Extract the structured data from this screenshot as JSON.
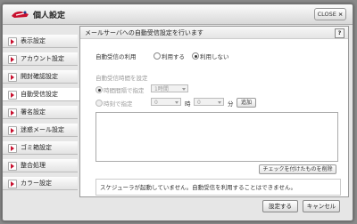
{
  "window": {
    "title": "個人設定",
    "close_label": "CLOSE",
    "close_x": "×"
  },
  "sidebar": {
    "items": [
      {
        "label": "表示設定"
      },
      {
        "label": "アカウント設定"
      },
      {
        "label": "開封確認設定"
      },
      {
        "label": "自動受信設定"
      },
      {
        "label": "署名設定"
      },
      {
        "label": "迷惑メール設定"
      },
      {
        "label": "ゴミ箱設定"
      },
      {
        "label": "整合処理"
      },
      {
        "label": "カラー設定"
      }
    ],
    "active_index": 3
  },
  "panel": {
    "title": "メールサーバへの自動受信設定を行います",
    "help_label": "?",
    "use_label": "自動受信の利用",
    "use_on_label": "利用する",
    "use_off_label": "利用しない",
    "time_section_label": "自動受信時間を設定",
    "interval_label": "時間間隔で指定",
    "interval_value": "1時間",
    "clock_label": "時刻で指定",
    "hour_value": "0",
    "hour_unit": "時",
    "minute_value": "0",
    "minute_unit": "分",
    "add_label": "追加",
    "delete_checked_label": "チェックを付けたものを削除",
    "status_message": "スケジューラが起動していません。自動受信を利用することはできません。"
  },
  "footer": {
    "save_label": "設定する",
    "cancel_label": "キャンセル"
  },
  "colors": {
    "accent": "#c8102e"
  }
}
